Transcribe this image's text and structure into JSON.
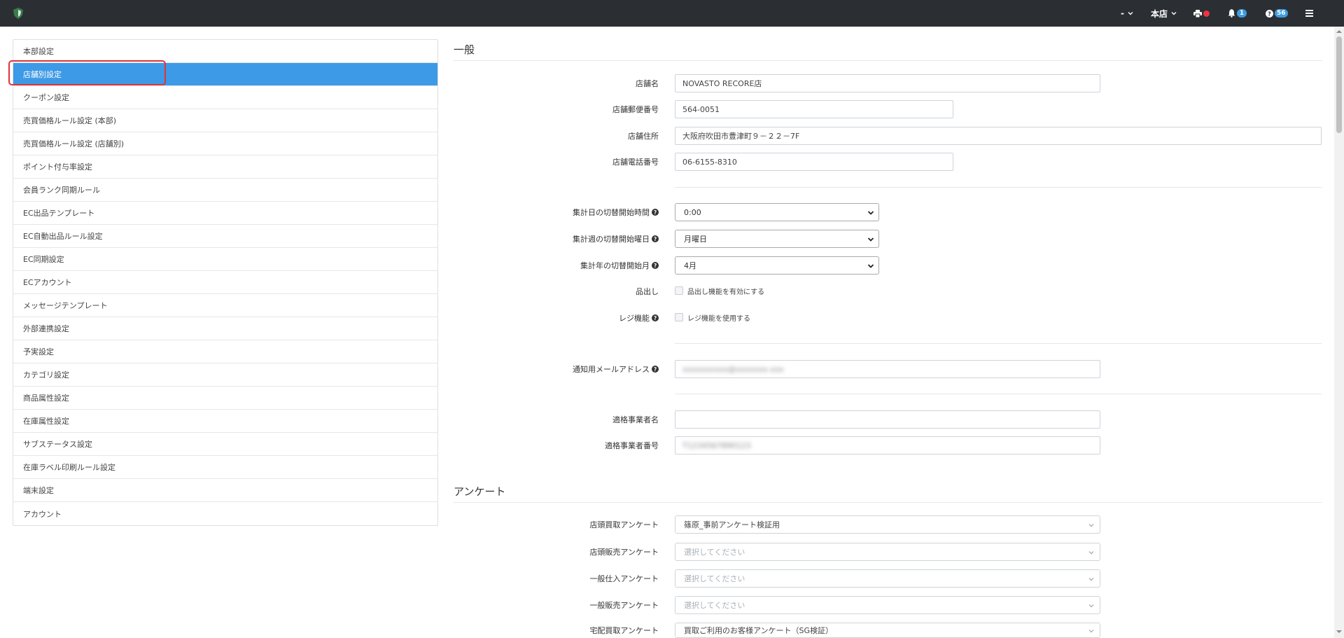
{
  "navbar": {
    "user_menu_label": "-",
    "store_menu_label": "本店",
    "notification_count": "1",
    "help_count": "56"
  },
  "sidebar": {
    "items": [
      {
        "label": "本部設定"
      },
      {
        "label": "店舗別設定"
      },
      {
        "label": "クーポン設定"
      },
      {
        "label": "売買価格ルール設定 (本部)"
      },
      {
        "label": "売買価格ルール設定 (店舗別)"
      },
      {
        "label": "ポイント付与率設定"
      },
      {
        "label": "会員ランク同期ルール"
      },
      {
        "label": "EC出品テンプレート"
      },
      {
        "label": "EC自動出品ルール設定"
      },
      {
        "label": "EC同期設定"
      },
      {
        "label": "ECアカウント"
      },
      {
        "label": "メッセージテンプレート"
      },
      {
        "label": "外部連携設定"
      },
      {
        "label": "予実設定"
      },
      {
        "label": "カテゴリ設定"
      },
      {
        "label": "商品属性設定"
      },
      {
        "label": "在庫属性設定"
      },
      {
        "label": "サブステータス設定"
      },
      {
        "label": "在庫ラベル印刷ルール設定"
      },
      {
        "label": "端末設定"
      },
      {
        "label": "アカウント"
      }
    ],
    "active_index": 1
  },
  "general": {
    "title": "一般",
    "store_name_label": "店舗名",
    "store_name_value": "NOVASTO RECORE店",
    "postal_label": "店舗郵便番号",
    "postal_value": "564-0051",
    "address_label": "店舗住所",
    "address_value": "大阪府吹田市豊津町９－２２－7F",
    "phone_label": "店舗電話番号",
    "phone_value": "06-6155-8310",
    "day_switch_label": "集計日の切替開始時間",
    "day_switch_value": "0:00",
    "week_switch_label": "集計週の切替開始曜日",
    "week_switch_value": "月曜日",
    "year_switch_label": "集計年の切替開始月",
    "year_switch_value": "4月",
    "shinadashi_label": "品出し",
    "shinadashi_check_label": "品出し機能を有効にする",
    "register_label": "レジ機能",
    "register_check_label": "レジ機能を使用する",
    "email_label": "通知用メールアドレス",
    "email_value": "xxxxxxxxxx@xxxxxxx.xxx",
    "invoice_name_label": "適格事業者名",
    "invoice_name_value": "",
    "invoice_number_label": "適格事業者番号",
    "invoice_number_value": "T1234567890123"
  },
  "survey": {
    "title": "アンケート",
    "store_buy_label": "店頭買取アンケート",
    "store_buy_value": "篠原_事前アンケート検証用",
    "store_sell_label": "店頭販売アンケート",
    "store_sell_placeholder": "選択してください",
    "general_purchase_label": "一般仕入アンケート",
    "general_purchase_placeholder": "選択してください",
    "general_sell_label": "一般販売アンケート",
    "general_sell_placeholder": "選択してください",
    "delivery_buy_label": "宅配買取アンケート",
    "delivery_buy_value": "買取ご利用のお客様アンケート（SG検証）"
  },
  "colors": {
    "navbar_bg": "#2b2f33",
    "active_item": "#3d9ae6",
    "highlight_border": "#e0333a",
    "badge": "#3e9be0"
  }
}
